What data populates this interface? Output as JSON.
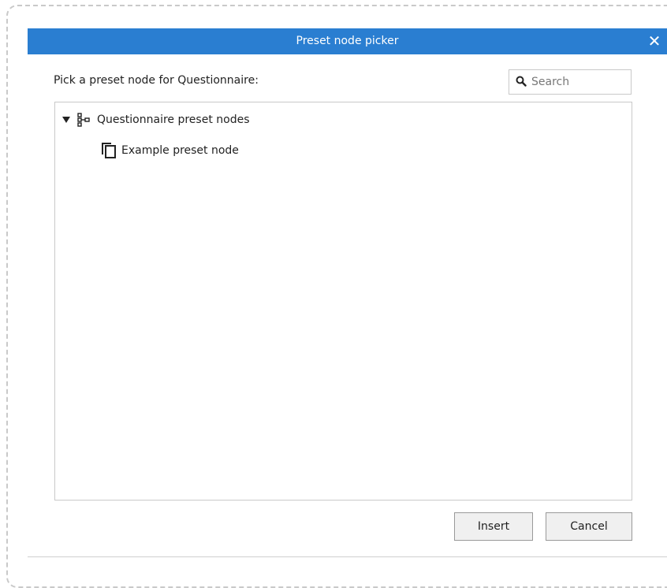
{
  "dialog": {
    "title": "Preset node picker",
    "close_glyph": "✕",
    "prompt": "Pick a preset node for Questionnaire:"
  },
  "search": {
    "placeholder": "Search",
    "value": "",
    "icon": "search-icon"
  },
  "tree": {
    "root": {
      "label": "Questionnaire preset nodes",
      "expanded": true,
      "icon": "hierarchy-icon",
      "children": [
        {
          "label": "Example preset node",
          "icon": "copy-icon"
        }
      ]
    }
  },
  "buttons": {
    "insert": "Insert",
    "cancel": "Cancel"
  },
  "colors": {
    "titlebar": "#2a7ed1"
  }
}
